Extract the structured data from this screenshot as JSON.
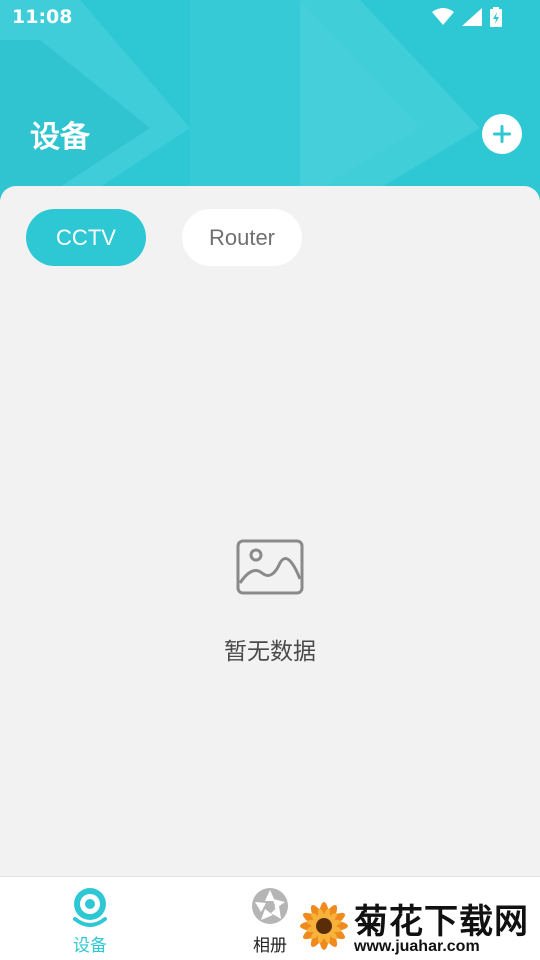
{
  "status_bar": {
    "time": "11:08",
    "icons": [
      "wifi-icon",
      "signal-icon",
      "battery-icon"
    ]
  },
  "header": {
    "title": "设备",
    "add_icon": "plus-icon",
    "accent_color": "#2ec8d4"
  },
  "tabs": [
    {
      "label": "CCTV",
      "selected": true
    },
    {
      "label": "Router",
      "selected": false
    }
  ],
  "empty_state": {
    "icon": "image-placeholder-icon",
    "text": "暂无数据"
  },
  "bottom_nav": {
    "items": [
      {
        "label": "设备",
        "icon": "camera-icon",
        "active": true
      },
      {
        "label": "相册",
        "icon": "aperture-icon",
        "active": false
      }
    ]
  },
  "watermark": {
    "title": "菊花下载网",
    "url": "www.juahar.com"
  }
}
